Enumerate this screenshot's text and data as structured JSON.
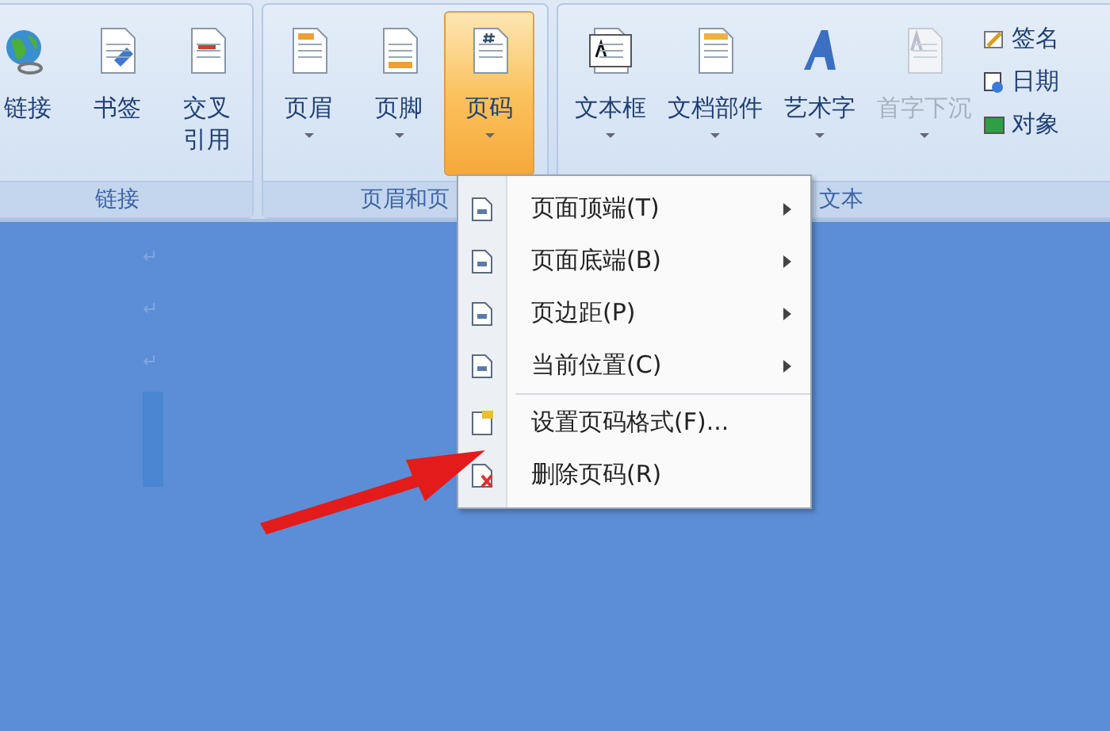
{
  "ribbon": {
    "groups": [
      {
        "label": "链接",
        "buttons": [
          {
            "label": "链接",
            "kind": "globe",
            "active": false,
            "disabled": false
          },
          {
            "label": "书签",
            "kind": "bookmark",
            "active": false,
            "disabled": false
          },
          {
            "label": "交叉引用",
            "kind": "crossref",
            "active": false,
            "disabled": false
          }
        ]
      },
      {
        "label": "页眉和页",
        "buttons": [
          {
            "label": "页眉",
            "kind": "header",
            "dropdown": true,
            "active": false,
            "disabled": false
          },
          {
            "label": "页脚",
            "kind": "footer",
            "dropdown": true,
            "active": false,
            "disabled": false
          },
          {
            "label": "页码",
            "kind": "pagenum",
            "dropdown": true,
            "active": true,
            "disabled": false
          }
        ]
      },
      {
        "label": "文本",
        "buttons": [
          {
            "label": "文本框",
            "kind": "textbox",
            "dropdown": true,
            "active": false,
            "disabled": false
          },
          {
            "label": "文档部件",
            "kind": "docparts",
            "dropdown": true,
            "active": false,
            "disabled": false
          },
          {
            "label": "艺术字",
            "kind": "wordart",
            "dropdown": true,
            "active": false,
            "disabled": false
          },
          {
            "label": "首字下沉",
            "kind": "dropcap",
            "dropdown": true,
            "active": false,
            "disabled": true
          }
        ],
        "small_buttons": [
          {
            "label": "签名",
            "kind": "signature"
          },
          {
            "label": "日期",
            "kind": "datetime"
          },
          {
            "label": "对象",
            "kind": "object"
          }
        ]
      }
    ]
  },
  "menu": {
    "items": [
      {
        "label": "页面顶端(T)",
        "kind": "page",
        "submenu": true
      },
      {
        "label": "页面底端(B)",
        "kind": "page",
        "submenu": true
      },
      {
        "label": "页边距(P)",
        "kind": "page",
        "submenu": true
      },
      {
        "label": "当前位置(C)",
        "kind": "page",
        "submenu": true
      },
      {
        "label": "设置页码格式(F)...",
        "kind": "format",
        "separator_before": true
      },
      {
        "label": "删除页码(R)",
        "kind": "delete"
      }
    ]
  }
}
